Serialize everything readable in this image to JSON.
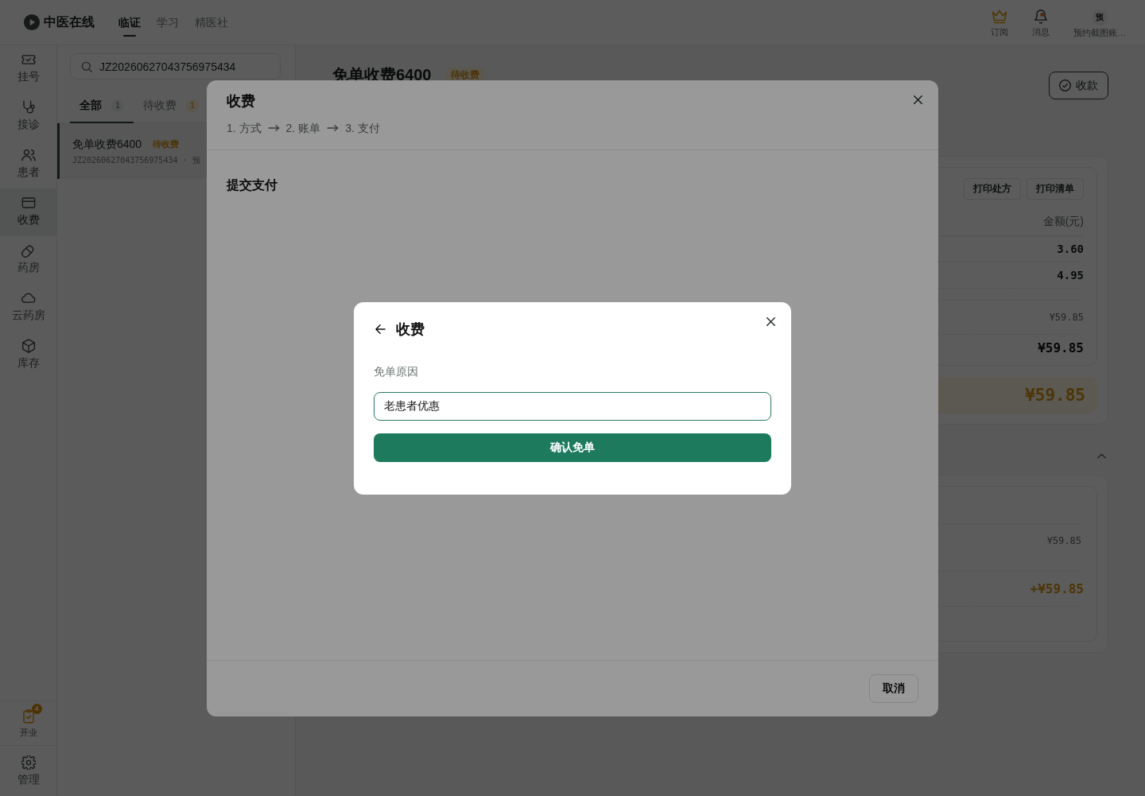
{
  "header": {
    "logo": "中医在线",
    "nav": [
      {
        "label": "临证",
        "selected": true
      },
      {
        "label": "学习",
        "selected": false
      },
      {
        "label": "精医社",
        "selected": false
      }
    ],
    "actions": [
      {
        "kind": "subscription",
        "label": "订阅"
      },
      {
        "kind": "messages",
        "label": "消息",
        "unread": true
      },
      {
        "kind": "account",
        "label": "预约截图账…",
        "avatar": "预"
      }
    ]
  },
  "sidebar": {
    "items": [
      {
        "label": "挂号",
        "selected": false
      },
      {
        "label": "接诊",
        "selected": false
      },
      {
        "label": "患者",
        "selected": false
      },
      {
        "label": "收费",
        "selected": true
      },
      {
        "label": "药房",
        "selected": false
      },
      {
        "label": "云药房",
        "selected": false
      },
      {
        "label": "库存",
        "selected": false
      }
    ],
    "bottom": [
      {
        "label": "开业",
        "badge": "4"
      },
      {
        "label": "管理"
      }
    ]
  },
  "list_panel": {
    "search": {
      "value": "JZ20260627043756975434"
    },
    "tabs": [
      {
        "label": "全部",
        "count": "1",
        "kind": "neutral",
        "selected": true
      },
      {
        "label": "待收费",
        "count": "1",
        "kind": "warning",
        "selected": false
      }
    ],
    "items": [
      {
        "title": "免单收费6400",
        "status": "待收费",
        "subtitle": "JZ20260627043756975434 · 预",
        "selected": true
      }
    ]
  },
  "detail": {
    "title": "免单收费6400",
    "status": "待收费",
    "collect_button": "收款",
    "print_buttons": [
      "打印处方",
      "打印清单"
    ],
    "amount_header": "金额(元)",
    "rows": [
      {
        "amount": "3.60"
      },
      {
        "amount": "4.95"
      }
    ],
    "subtotal": "¥59.85",
    "total": "¥59.85",
    "due": "¥59.85",
    "payments_expanded": true,
    "payments": [
      {
        "amount": "¥59.85",
        "kind": "muted"
      },
      {
        "amount": "+¥59.85",
        "kind": "accent"
      }
    ]
  },
  "charge_dialog": {
    "title": "收费",
    "steps": [
      "1. 方式",
      "2. 账单",
      "3. 支付"
    ],
    "section_title": "提交支付",
    "cancel_button": "取消"
  },
  "waiver_dialog": {
    "title": "收费",
    "field_label": "免单原因",
    "reason": {
      "value": "老患者优惠"
    },
    "confirm_button": "确认免单"
  }
}
